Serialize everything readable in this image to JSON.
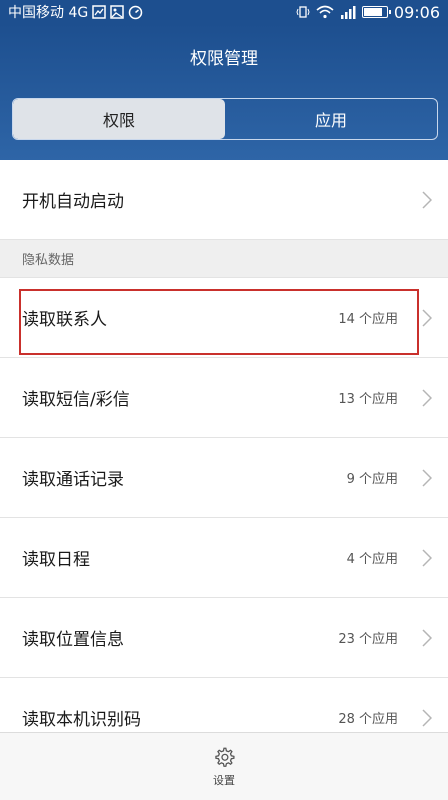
{
  "status_bar": {
    "carrier": "中国移动 4G",
    "time": "09:06",
    "battery_level": 0.85
  },
  "header": {
    "title": "权限管理",
    "tabs": [
      {
        "label": "权限",
        "active": true
      },
      {
        "label": "应用",
        "active": false
      }
    ]
  },
  "rows_top": [
    {
      "label": "开机自动启动",
      "count": ""
    }
  ],
  "section_privacy": {
    "title": "隐私数据",
    "items": [
      {
        "label": "读取联系人",
        "count": "14 个应用"
      },
      {
        "label": "读取短信/彩信",
        "count": "13 个应用"
      },
      {
        "label": "读取通话记录",
        "count": "9 个应用"
      },
      {
        "label": "读取日程",
        "count": "4 个应用"
      },
      {
        "label": "读取位置信息",
        "count": "23 个应用"
      },
      {
        "label": "读取本机识别码",
        "count": "28 个应用"
      }
    ]
  },
  "bottom_bar": {
    "settings_label": "设置",
    "settings_icon": "gear-icon"
  },
  "colors": {
    "header_blue": "#1d4f8f",
    "highlight_red": "#c9302c"
  }
}
